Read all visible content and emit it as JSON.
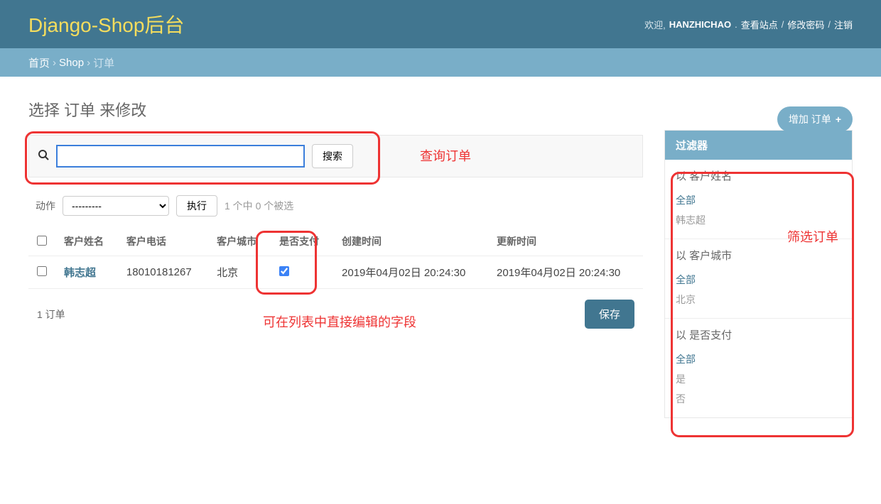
{
  "header": {
    "site_title": "Django-Shop后台",
    "welcome": "欢迎,",
    "username": "HANZHICHAO",
    "view_site": "查看站点",
    "change_password": "修改密码",
    "logout": "注销"
  },
  "breadcrumbs": {
    "home": "首页",
    "app": "Shop",
    "current": "订单"
  },
  "page": {
    "title": "选择 订单 来修改",
    "add_label": "增加 订单"
  },
  "search": {
    "button": "搜索",
    "placeholder": ""
  },
  "annotations": {
    "search": "查询订单",
    "editable": "可在列表中直接编辑的字段",
    "filter": "筛选订单"
  },
  "actions": {
    "label": "动作",
    "default_option": "---------",
    "go": "执行",
    "counter": "1 个中 0 个被选"
  },
  "table": {
    "columns": {
      "name": "客户姓名",
      "phone": "客户电话",
      "city": "客户城市",
      "paid": "是否支付",
      "created": "创建时间",
      "updated": "更新时间"
    },
    "rows": [
      {
        "name": "韩志超",
        "phone": "18010181267",
        "city": "北京",
        "paid": true,
        "created": "2019年04月02日 20:24:30",
        "updated": "2019年04月02日 20:24:30"
      }
    ],
    "count_label": "1 订单",
    "save": "保存"
  },
  "filter": {
    "header": "过滤器",
    "sections": [
      {
        "title": "以 客户姓名",
        "options": [
          "全部",
          "韩志超"
        ]
      },
      {
        "title": "以 客户城市",
        "options": [
          "全部",
          "北京"
        ]
      },
      {
        "title": "以 是否支付",
        "options": [
          "全部",
          "是",
          "否"
        ]
      }
    ]
  }
}
